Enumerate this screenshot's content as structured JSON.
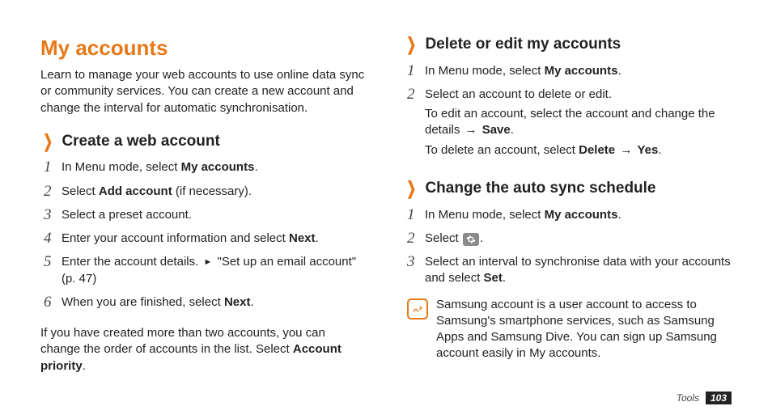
{
  "title": "My accounts",
  "intro": "Learn to manage your web accounts to use online data sync or community services. You can create a new account and change the interval for automatic synchronisation.",
  "create": {
    "heading": "Create a web account",
    "steps": {
      "s1a": "In Menu mode, select ",
      "s1b": "My accounts",
      "s2a": "Select ",
      "s2b": "Add account",
      "s2c": " (if necessary).",
      "s3": "Select a preset account.",
      "s4a": "Enter your account information and select ",
      "s4b": "Next",
      "s5a": "Enter the account details. ",
      "s5b": "\"Set up an email account\" (p. 47)",
      "s6a": "When you are finished, select ",
      "s6b": "Next"
    },
    "after_a": "If you have created more than two accounts, you can change the order of accounts in the list. Select ",
    "after_b": "Account priority"
  },
  "delete": {
    "heading": "Delete or edit my accounts",
    "s1a": "In Menu mode, select ",
    "s1b": "My accounts",
    "s2a": "Select an account to delete or edit.",
    "s2b": "To edit an account, select the account and change the details ",
    "s2c": "Save",
    "s2d": "To delete an account, select ",
    "s2e": "Delete",
    "s2f": "Yes"
  },
  "sync": {
    "heading": "Change the auto sync schedule",
    "s1a": "In Menu mode, select ",
    "s1b": "My accounts",
    "s2a": "Select ",
    "s3a": "Select an interval to synchronise data with your accounts and select ",
    "s3b": "Set",
    "note": "Samsung account is a user account to access to Samsung's smartphone services, such as Samsung Apps and Samsung Dive. You can sign up Samsung account easily in My accounts."
  },
  "nums": {
    "n1": "1",
    "n2": "2",
    "n3": "3",
    "n4": "4",
    "n5": "5",
    "n6": "6"
  },
  "footer": {
    "section": "Tools",
    "page": "103"
  }
}
